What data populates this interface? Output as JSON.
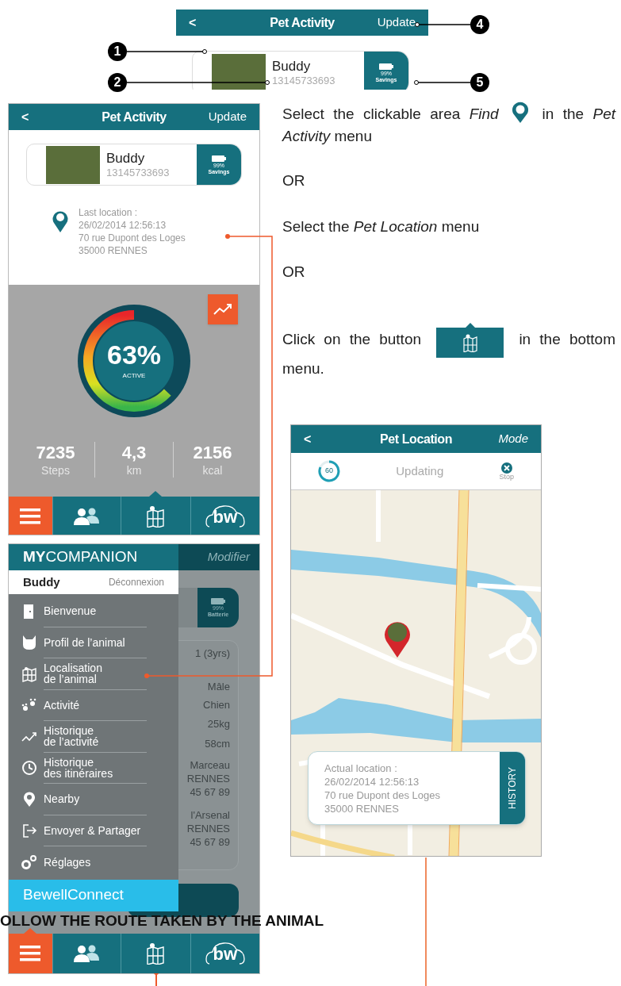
{
  "top_strip": {
    "header": {
      "back": "<",
      "title": "Pet Activity",
      "action": "Update"
    },
    "pet_card": {
      "name": "Buddy",
      "number": "13145733693",
      "battery_percent": "99%",
      "battery_label": "Savings"
    },
    "callouts": [
      "1",
      "2",
      "4",
      "5"
    ]
  },
  "pet_activity_screen": {
    "header": {
      "back": "<",
      "title": "Pet Activity",
      "action": "Update"
    },
    "pet_card": {
      "name": "Buddy",
      "number": "13145733693",
      "battery_percent": "99%",
      "battery_label": "Savings"
    },
    "last_location": [
      "Last location :",
      "26/02/2014 12:56:13",
      "70 rue Dupont des Loges",
      "35000 RENNES"
    ],
    "activity": {
      "level": 0.63,
      "percent": "63%",
      "label": "ACTIVE"
    },
    "stats": [
      {
        "value": "7235",
        "unit": "Steps"
      },
      {
        "value": "4,3",
        "unit": "km"
      },
      {
        "value": "2156",
        "unit": "kcal"
      }
    ],
    "nav": [
      {
        "kind": "menu",
        "selected": false
      },
      {
        "kind": "contacts",
        "selected": false
      },
      {
        "kind": "map",
        "selected": true
      },
      {
        "kind": "brand",
        "text": "bw",
        "selected": false
      }
    ]
  },
  "instructions": [
    {
      "kind": "inline",
      "before": "Select the clickable area *Find*",
      "after": "in the *Pet Activity* menu"
    },
    {
      "kind": "text",
      "text": "OR"
    },
    {
      "kind": "text",
      "text": "Select the *Pet Location* menu"
    },
    {
      "kind": "text",
      "text": "OR"
    },
    {
      "kind": "inline",
      "before": "Click on the button",
      "after": "in the bottom menu."
    }
  ],
  "menu_screen": {
    "background": {
      "action": "Modifier",
      "battery_percent": "99%",
      "battery_label": "Batterie",
      "details": [
        "1 (3yrs)",
        "Mâle",
        "Chien",
        "25kg",
        "58cm",
        "Marceau",
        "RENNES",
        "45 67 89",
        "l'Arsenal",
        "RENNES",
        "45 67 89"
      ]
    },
    "menu": {
      "brand_bold": "MY",
      "brand": "COMPANION",
      "user": "Buddy",
      "logout": "Déconnexion",
      "items": [
        {
          "kind": "door",
          "label": "Bienvenue"
        },
        {
          "kind": "cat",
          "label": "Profil de l’animal"
        },
        {
          "kind": "map",
          "label": "Localisation\nde l’animal"
        },
        {
          "kind": "paws",
          "label": "Activité"
        },
        {
          "kind": "trend",
          "label": "Historique\nde l’activité"
        },
        {
          "kind": "clock",
          "label": "Historique\ndes itinéraires"
        },
        {
          "kind": "pin",
          "label": "Nearby"
        },
        {
          "kind": "share",
          "label": "Envoyer & Partager"
        },
        {
          "kind": "gears",
          "label": "Réglages"
        }
      ],
      "footer": "BewellConnect"
    },
    "nav": [
      {
        "kind": "menu",
        "selected": true
      },
      {
        "kind": "contacts",
        "selected": false
      },
      {
        "kind": "map",
        "selected": false
      },
      {
        "kind": "brand",
        "text": "bw",
        "selected": false
      }
    ]
  },
  "heading": "OLLOW THE ROUTE TAKEN BY THE ANIMAL",
  "pet_location_screen": {
    "header": {
      "back": "<",
      "title": "Pet Location",
      "action": "Mode"
    },
    "timer": "60",
    "status": "Updating",
    "stop": "Stop",
    "location": [
      "Actual location :",
      "26/02/2014 12:56:13",
      "70 rue Dupont des Loges",
      "35000 RENNES"
    ],
    "history": "HISTORY"
  }
}
